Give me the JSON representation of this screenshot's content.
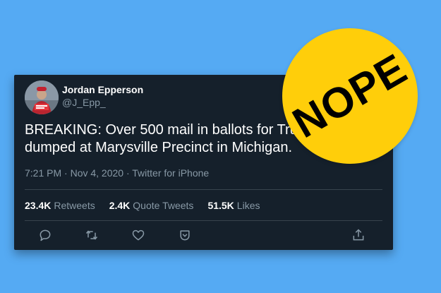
{
  "tweet": {
    "display_name": "Jordan Epperson",
    "handle": "@J_Epp_",
    "text_lines": [
      "BREAKING: Over 500 mail in ballots for Trump",
      "dumped at Marysville Precinct in Michigan."
    ],
    "meta": "7:21 PM · Nov 4, 2020 · Twitter for iPhone",
    "stats": [
      {
        "value": "23.4K",
        "label": "Retweets"
      },
      {
        "value": "2.4K",
        "label": "Quote Tweets"
      },
      {
        "value": "51.5K",
        "label": "Likes"
      }
    ],
    "actions": [
      "reply-icon",
      "retweet-icon",
      "like-icon",
      "save-icon",
      "share-icon"
    ]
  },
  "badge": {
    "text": "NOPE",
    "color": "#ffce0a"
  },
  "colors": {
    "background": "#55aaf3",
    "card": "#15202b",
    "secondary_text": "#8899a6",
    "divider": "#38444d"
  }
}
